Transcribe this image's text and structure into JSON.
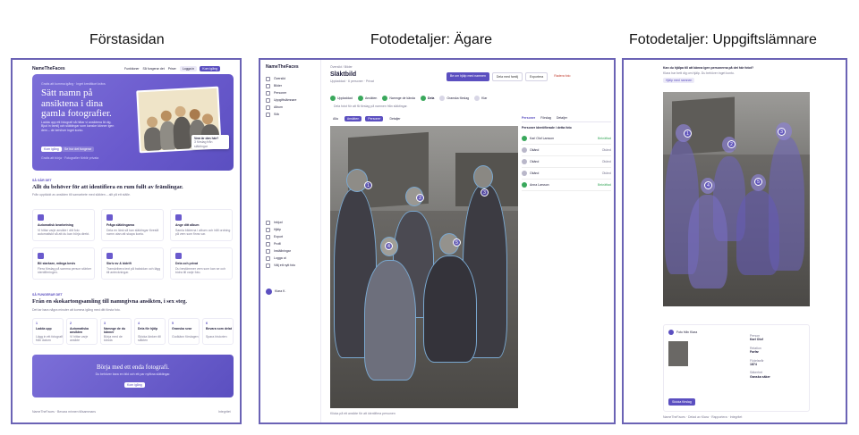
{
  "panels": {
    "landing_title": "Förstasidan",
    "owner_title": "Fotodetaljer: Ägare",
    "contributor_title": "Fotodetaljer: Uppgiftslämnare"
  },
  "landing": {
    "logo": "NameTheFaces",
    "nav": [
      "Funktioner",
      "Så fungerar det",
      "Priser",
      "Logga in"
    ],
    "nav_cta": "Kom igång",
    "hero": {
      "eyebrow": "Gratis att komma igång · Inget kreditkort krävs",
      "heading": "Sätt namn på ansiktena i dina gamla fotografier.",
      "body": "Ladda upp ett fotografi så hittar vi ansiktena åt dig. Bjud in familj och släktingar som kanske känner igen dem – de behöver inget konto.",
      "cta_primary": "Kom igång",
      "cta_secondary": "Se hur det fungerar",
      "note": "Gratis att börja · Fotografier förblir privata",
      "card_label": "Vem är den här?",
      "card_sub": "3 förslag från släktingar"
    },
    "section1": {
      "eyebrow": "SÅ GÅR DET",
      "heading": "Allt du behöver för att identifiera en rum fullt av främlingar.",
      "sub": "Från upptäckt av ansikten till samarbete med släkten – allt på ett ställe."
    },
    "features": [
      {
        "title": "Automatisk bearbetning",
        "desc": "Vi hittar varje ansikte i ditt foto automatiskt så att du kan börja direkt."
      },
      {
        "title": "Fråga släktingarna",
        "desc": "Dela en länk så kan släktingar föreslå namn utan att skapa konto."
      },
      {
        "title": "Ange ditt album",
        "desc": "Samla bilderna i album och håll ordning på vem som finns var."
      },
      {
        "title": "Bli starkare, många bevis",
        "desc": "Flera förslag på samma person stärker identifieringen."
      },
      {
        "title": "Skriv av & bidrift",
        "desc": "Transkribera text på baksidan och lägg till anteckningar."
      },
      {
        "title": "Dela och privat",
        "desc": "Du bestämmer vem som kan se och bidra till varje foto."
      }
    ],
    "section2": {
      "eyebrow": "SÅ FUNGERAR DET",
      "heading": "Från en skokartongsamling till namngivna ansikten, i sex steg.",
      "sub": "Det tar bara några minuter att komma igång med ditt första foto."
    },
    "steps": [
      {
        "n": "1",
        "title": "Ladda upp",
        "desc": "Lägg in ett fotografi från datorn"
      },
      {
        "n": "2",
        "title": "Automatiska ansikten",
        "desc": "Vi hittar varje ansikte"
      },
      {
        "n": "3",
        "title": "Namnge de du känner",
        "desc": "Börja med de kända"
      },
      {
        "n": "4",
        "title": "Dela för hjälp",
        "desc": "Skicka länken till släkten"
      },
      {
        "n": "5",
        "title": "Granska svar",
        "desc": "Godkänn förslagen"
      },
      {
        "n": "6",
        "title": "Bevara som delat",
        "desc": "Spara historien"
      }
    ],
    "cta_band": {
      "heading": "Börja med ett enda fotografi.",
      "sub": "Du behöver bara en bild och ett par nyfikna släktingar.",
      "button": "Kom igång"
    },
    "footer_left": "NameTheFaces · Bevara minnen tillsammans",
    "footer_right": "Integritet"
  },
  "owner": {
    "logo": "NameTheFaces",
    "sidebar": [
      "Översikt",
      "Bilder",
      "Personer",
      "Uppgiftslämnare",
      "Album",
      "Sök"
    ],
    "sidebar_bottom": [
      "Inbjud",
      "Hjälp",
      "Export",
      "Profil",
      "Inställningar",
      "Logga ut",
      "Välj ett nytt foto"
    ],
    "user": "Klara K.",
    "breadcrumb": "Översikt / Bilder",
    "photo_title": "Släktbild",
    "photo_meta": "Uppladdad · 6 personer · Privat",
    "buttons": {
      "primary": "Be om hjälp med namnen",
      "share": "Dela med familj",
      "export": "Exportera",
      "delete": "Radera foto"
    },
    "progress": [
      "Uppladdad",
      "Ansikten",
      "Namnge de kända",
      "Dela",
      "Granska förslag",
      "Klar"
    ],
    "progress_note": "Dela fotot för att få förslag på namnen från släktingar.",
    "tabs": [
      "Alla",
      "Ansikten",
      "Personer",
      "Detaljer"
    ],
    "panel_tabs": [
      "Personer",
      "Förslag",
      "Detaljer"
    ],
    "panel_heading": "Personer identifierade i detta foto",
    "people": [
      {
        "name": "Karl Olof Larsson",
        "status": "Bekräftad"
      },
      {
        "name": "Okänd",
        "status": "Okänd"
      },
      {
        "name": "Okänd",
        "status": "Okänd"
      },
      {
        "name": "Okänd",
        "status": "Okänd"
      },
      {
        "name": "Anna Larsson",
        "status": "Bekräftad"
      }
    ],
    "caption": "Klicka på ett ansikte för att identifiera personen"
  },
  "contributor": {
    "question": "Kan du hjälpa till att känna igen personerna på det här fotot?",
    "sub": "Klara har bett dig om hjälp. Du behöver inget konto.",
    "chip": "Hjälp med namnen",
    "faces": [
      "1",
      "2",
      "3",
      "4",
      "5"
    ],
    "owner_label": "Foto från Klara",
    "fields": [
      {
        "label": "Person",
        "value": "Karl Olof"
      },
      {
        "label": "Relation",
        "value": "Farfar"
      },
      {
        "label": "Födelseår",
        "value": "1874"
      },
      {
        "label": "Säkerhet",
        "value": "Ganska säker"
      }
    ],
    "submit": "Skicka förslag",
    "footer": "NameTheFaces · Delad av Klara · Rapportera · Integritet"
  },
  "colors": {
    "accent": "#5b4fc0",
    "frame": "#6b63b5",
    "success": "#3aa85c"
  }
}
